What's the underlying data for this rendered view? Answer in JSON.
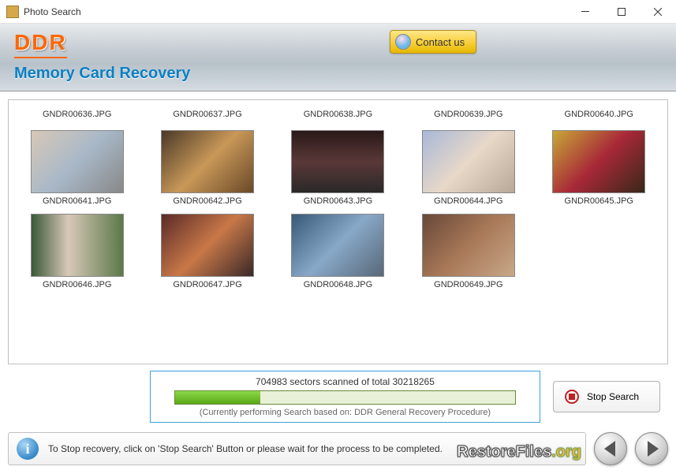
{
  "window": {
    "title": "Photo Search"
  },
  "header": {
    "logo": "DDR",
    "subtitle": "Memory Card Recovery",
    "contact_label": "Contact us"
  },
  "thumbnails_row1": [
    {
      "label": "GNDR00636.JPG"
    },
    {
      "label": "GNDR00637.JPG"
    },
    {
      "label": "GNDR00638.JPG"
    },
    {
      "label": "GNDR00639.JPG"
    },
    {
      "label": "GNDR00640.JPG"
    }
  ],
  "thumbnails_row2": [
    {
      "label": "GNDR00641.JPG",
      "cls": "p641"
    },
    {
      "label": "GNDR00642.JPG",
      "cls": "p642"
    },
    {
      "label": "GNDR00643.JPG",
      "cls": "p643"
    },
    {
      "label": "GNDR00644.JPG",
      "cls": "p644"
    },
    {
      "label": "GNDR00645.JPG",
      "cls": "p645"
    }
  ],
  "thumbnails_row3": [
    {
      "label": "GNDR00646.JPG",
      "cls": "p646"
    },
    {
      "label": "GNDR00647.JPG",
      "cls": "p647"
    },
    {
      "label": "GNDR00648.JPG",
      "cls": "p648"
    },
    {
      "label": "GNDR00649.JPG",
      "cls": "p649"
    }
  ],
  "progress": {
    "sectors_scanned": 704983,
    "sectors_total": 30218265,
    "text": "704983 sectors scanned of total 30218265",
    "subtext": "(Currently performing Search based on:  DDR General Recovery Procedure)",
    "percent": 25
  },
  "buttons": {
    "stop_label": "Stop Search"
  },
  "footer": {
    "info_text": "To Stop recovery, click on 'Stop Search' Button or please wait for the process to be completed."
  },
  "watermark": {
    "a": "RestoreFiles",
    "b": ".org"
  }
}
